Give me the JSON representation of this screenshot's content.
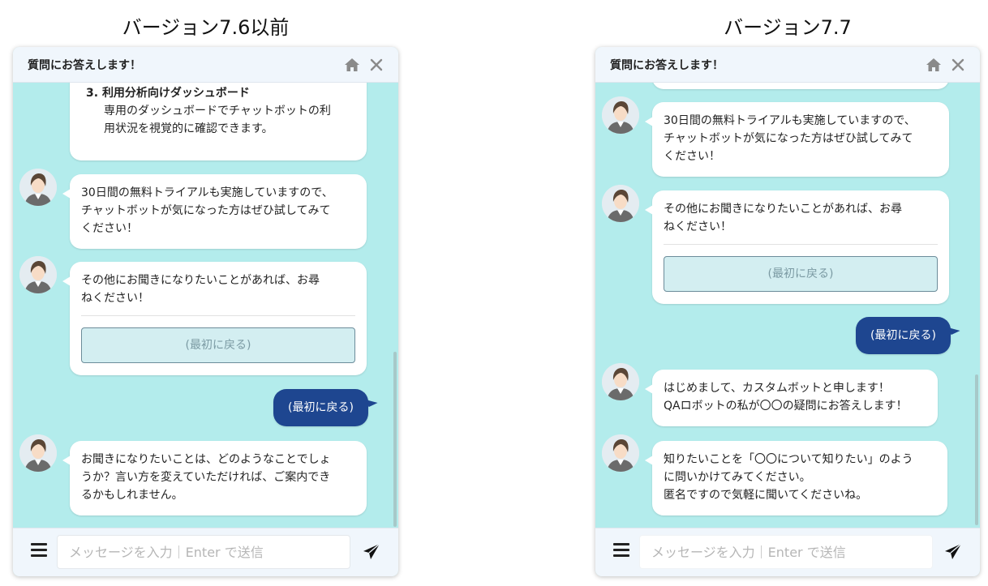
{
  "panels": {
    "left": {
      "title": "バージョン7.6以前",
      "header_title": "質問にお答えします！",
      "list_item_number": "3.",
      "list_item_title": "利用分析向けダッシュボード",
      "list_item_desc_1": "専用のダッシュボードでチャットボットの利",
      "list_item_desc_2": "用状況を視覚的に確認できます。",
      "trial_1": "30日間の無料トライアルも実施していますので、",
      "trial_2": "チャットボットが気になった方はぜひ試してみて",
      "trial_3": "ください！",
      "other_1": "その他にお聞きになりたいことがあれば、お尋",
      "other_2": "ねください！",
      "back_option": "(最初に戻る)",
      "user_reply": "(最初に戻る)",
      "fallback_1": "お聞きになりたいことは、どのようなことでしょ",
      "fallback_2": "うか？言い方を変えていただければ、ご案内でき",
      "fallback_3": "るかもしれません。",
      "input_placeholder": "メッセージを入力｜Enter で送信"
    },
    "right": {
      "title": "バージョン7.7",
      "header_title": "質問にお答えします！",
      "trial_1": "30日間の無料トライアルも実施していますので、",
      "trial_2": "チャットボットが気になった方はぜひ試してみて",
      "trial_3": "ください！",
      "other_1": "その他にお聞きになりたいことがあれば、お尋",
      "other_2": "ねください！",
      "back_option": "(最初に戻る)",
      "user_reply": "(最初に戻る)",
      "greet_1": "はじめまして、カスタムボットと申します！",
      "greet_2": "QAロボットの私が〇〇の疑問にお答えします！",
      "hint_1": "知りたいことを「〇〇について知りたい」のよう",
      "hint_2": "に問いかけてみてください。",
      "hint_3": "匿名ですので気軽に聞いてくださいね。",
      "input_placeholder": "メッセージを入力｜Enter で送信"
    }
  },
  "icons": {
    "home": "home-icon",
    "close": "close-icon",
    "menu": "menu-icon",
    "send": "send-icon",
    "avatar": "avatar"
  },
  "colors": {
    "chat_background": "#b3ecec",
    "header_background": "#f0f6fc",
    "user_bubble": "#1e4690",
    "bot_bubble": "#ffffff",
    "option_button": "#d3eef1"
  }
}
